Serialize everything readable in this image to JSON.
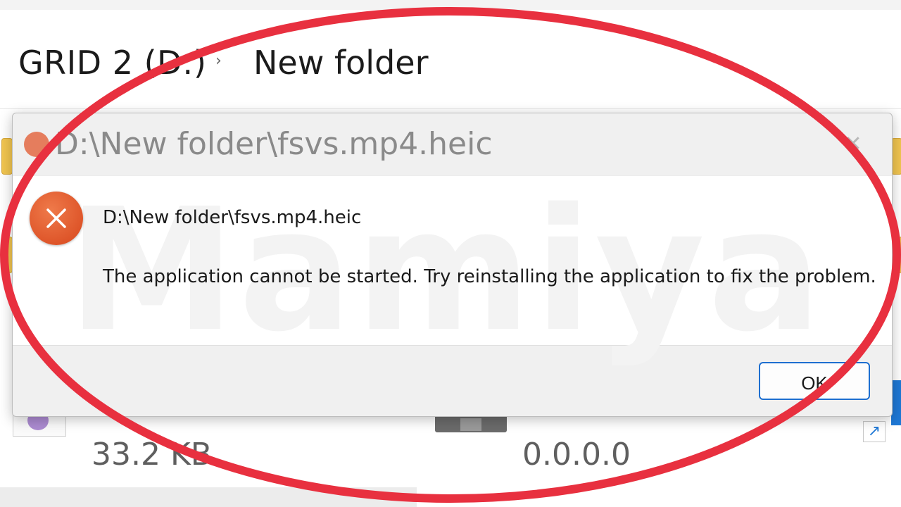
{
  "breadcrumb": {
    "drive_label": "GRID 2 (D:)",
    "separator": "›",
    "folder_label": "New folder"
  },
  "background": {
    "file_size": "33.2 KB",
    "version": "0.0.0.0",
    "shortcut_glyph": "↗"
  },
  "dialog": {
    "title": "D:\\New folder\\fsvs.mp4.heic",
    "close_glyph": "✕",
    "watermark": "Mamiya",
    "path_text": "D:\\New folder\\fsvs.mp4.heic",
    "message": "The application cannot be started. Try reinstalling the application to fix the problem.",
    "ok_label": "OK",
    "error_icon": "error-x-icon"
  },
  "colors": {
    "annotation_red": "#e8303f",
    "error_orange": "#e2572c",
    "accent_blue": "#1e6fd0"
  }
}
